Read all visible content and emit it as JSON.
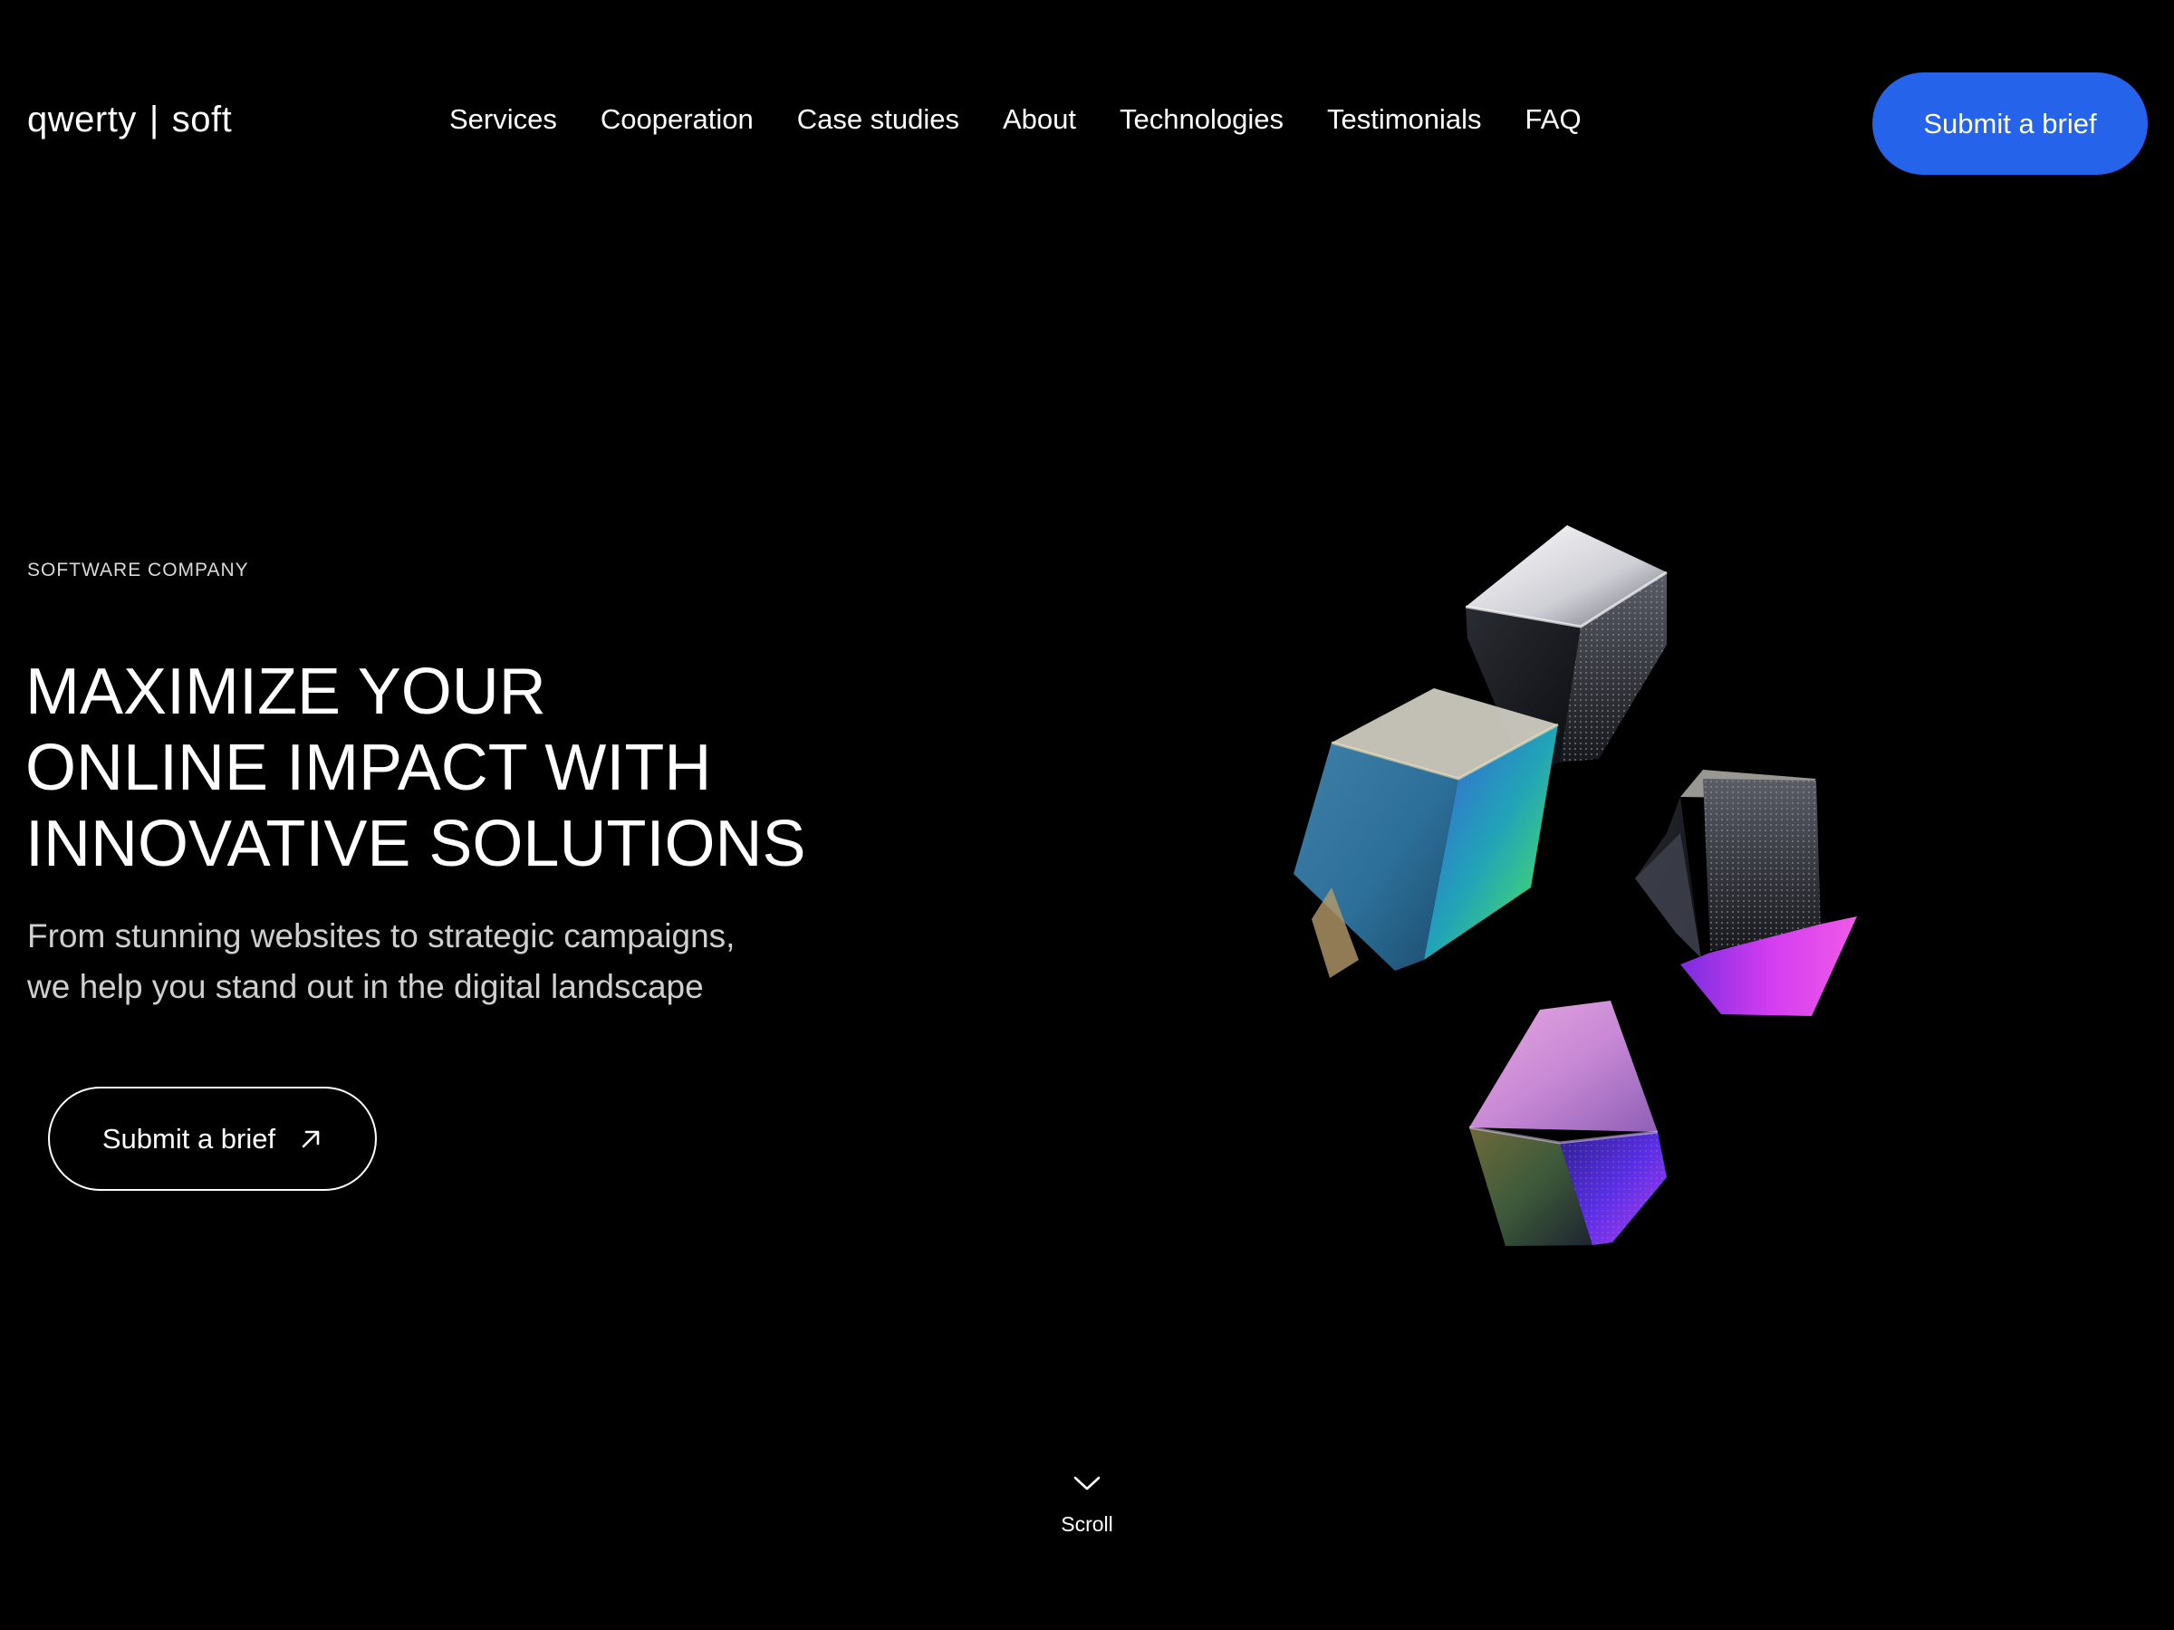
{
  "header": {
    "logo_left": "qwerty",
    "logo_sep": "|",
    "logo_right": "soft",
    "nav": [
      {
        "label": "Services"
      },
      {
        "label": "Cooperation"
      },
      {
        "label": "Case studies"
      },
      {
        "label": "About"
      },
      {
        "label": "Technologies"
      },
      {
        "label": "Testimonials"
      },
      {
        "label": "FAQ"
      }
    ],
    "cta_label": "Submit a brief"
  },
  "hero": {
    "eyebrow": "SOFTWARE COMPANY",
    "headline_lines": [
      "MAXIMIZE YOUR",
      "ONLINE IMPACT WITH",
      "INNOVATIVE SOLUTIONS"
    ],
    "subhead_lines": [
      "From stunning websites to strategic campaigns,",
      "we help you stand out in the digital landscape"
    ],
    "cta_label": "Submit a brief",
    "cta_icon": "arrow-up-right-icon"
  },
  "scroll": {
    "icon": "chevron-down-icon",
    "label": "Scroll"
  },
  "colors": {
    "background": "#000000",
    "accent": "#2563eb",
    "text": "#ffffff",
    "muted_text": "#cfcfcf"
  }
}
